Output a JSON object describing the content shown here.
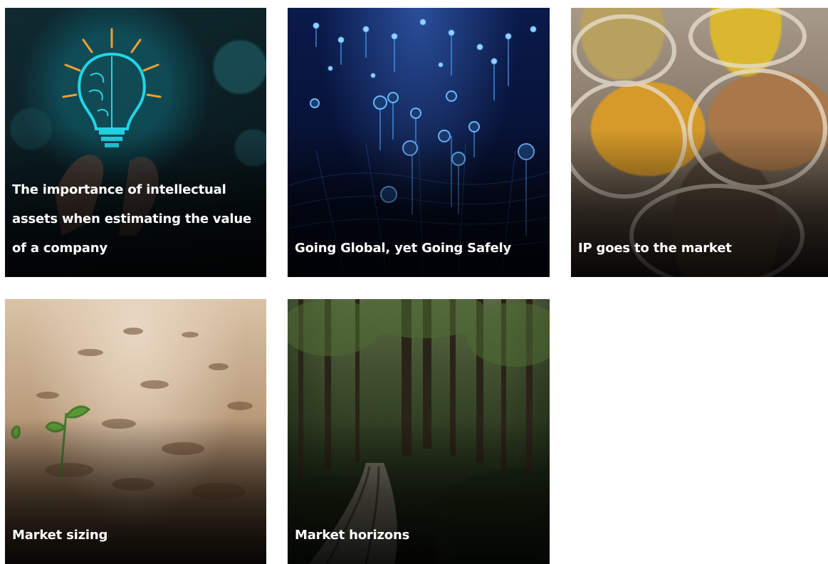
{
  "cards": [
    {
      "title": "The importance of intellectual assets when estimating the value of a company",
      "image": "lightbulb-brain-hand"
    },
    {
      "title": "Going Global, yet Going Safely",
      "image": "global-network-pins"
    },
    {
      "title": "IP goes to the market",
      "image": "spice-sacks-market"
    },
    {
      "title": "Market sizing",
      "image": "sprout-in-soil"
    },
    {
      "title": "Market horizons",
      "image": "forest-path"
    }
  ]
}
